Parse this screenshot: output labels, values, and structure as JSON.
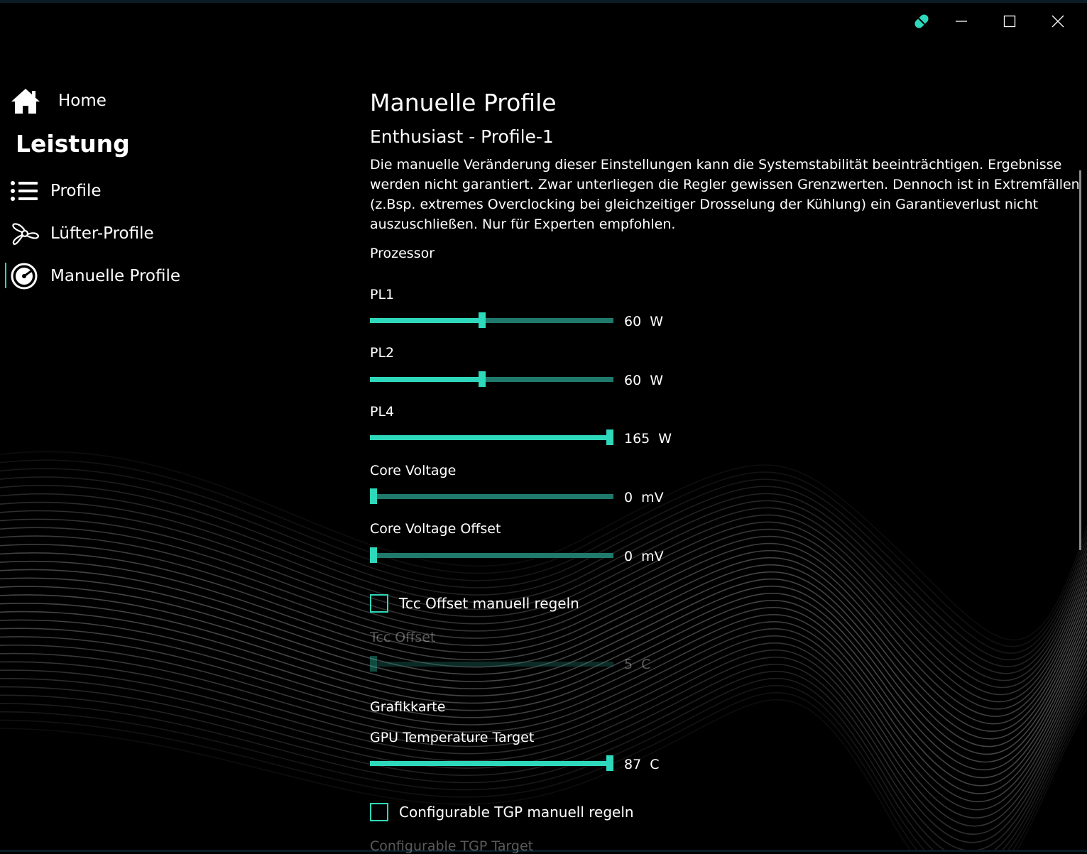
{
  "colors": {
    "accent": "#2ed8bb",
    "track": "#1f7a6c",
    "background": "#000000"
  },
  "titlebar": {
    "app_icon": "pill-icon",
    "minimize_icon": "minimize-icon",
    "maximize_icon": "maximize-icon",
    "close_icon": "close-icon"
  },
  "nav": {
    "home": {
      "label": "Home",
      "icon": "home-icon"
    },
    "section": "Leistung",
    "items": [
      {
        "label": "Profile",
        "icon": "list-icon"
      },
      {
        "label": "Lüfter-Profile",
        "icon": "fan-icon"
      },
      {
        "label": "Manuelle Profile",
        "icon": "gauge-icon",
        "active": true
      }
    ]
  },
  "main": {
    "title": "Manuelle Profile",
    "subtitle": "Enthusiast - Profile-1",
    "warning": "Die manuelle Veränderung dieser Einstellungen kann die Systemstabilität beeinträchtigen. Ergebnisse werden nicht garantiert. Zwar unterliegen die Regler gewissen Grenzwerten. Dennoch ist in Extremfällen (z.Bsp. extremes Overclocking bei gleichzeitiger Drosselung der Kühlung) ein Garantieverlust nicht auszuschließen. Nur für Experten empfohlen.",
    "processor_group": "Prozessor",
    "graphics_group": "Grafikkarte",
    "sliders": {
      "pl1": {
        "label": "PL1",
        "value": "60",
        "unit": "W",
        "fraction": 0.46
      },
      "pl2": {
        "label": "PL2",
        "value": "60",
        "unit": "W",
        "fraction": 0.46
      },
      "pl4": {
        "label": "PL4",
        "value": "165",
        "unit": "W",
        "fraction": 1.0
      },
      "core_voltage": {
        "label": "Core Voltage",
        "value": "0",
        "unit": "mV",
        "fraction": 0.0
      },
      "core_voltage_offset": {
        "label": "Core Voltage Offset",
        "value": "0",
        "unit": "mV",
        "fraction": 0.0
      },
      "tcc_offset": {
        "label": "Tcc Offset",
        "value": "5",
        "unit": "C",
        "fraction": 0.0,
        "disabled": true
      },
      "gpu_temp_target": {
        "label": "GPU Temperature Target",
        "value": "87",
        "unit": "C",
        "fraction": 1.0
      },
      "tgp_target": {
        "label": "Configurable TGP Target"
      }
    },
    "checkboxes": {
      "tcc": {
        "label": "Tcc Offset manuell regeln",
        "checked": false
      },
      "tgp": {
        "label": "Configurable TGP manuell regeln",
        "checked": false
      }
    }
  }
}
